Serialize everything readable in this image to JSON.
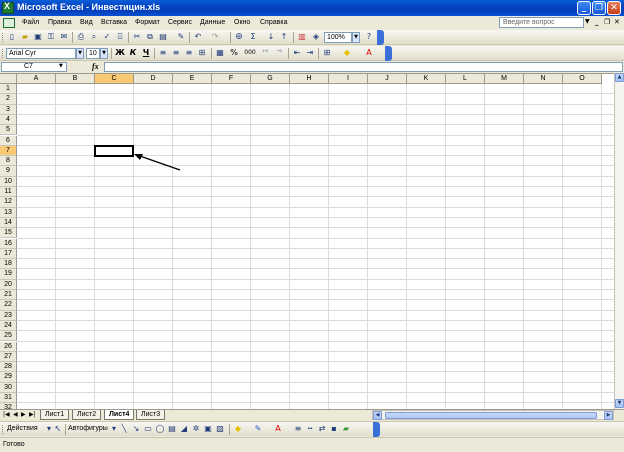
{
  "window": {
    "title": "Microsoft Excel - Инвестицин.xls"
  },
  "menu": {
    "items": [
      "Файл",
      "Правка",
      "Вид",
      "Вставка",
      "Формат",
      "Сервис",
      "Данные",
      "Окно",
      "Справка"
    ],
    "ask_placeholder": "Введите вопрос"
  },
  "standard_toolbar": {
    "zoom": "100%"
  },
  "format_toolbar": {
    "font": "Arial Cyr",
    "size": "10",
    "bold": "Ж",
    "italic": "К",
    "underline": "Ч",
    "percent": "%",
    "thousands": "000"
  },
  "formula_bar": {
    "name_box": "C7",
    "fx": "fx",
    "value": ""
  },
  "grid": {
    "columns": [
      "A",
      "B",
      "C",
      "D",
      "E",
      "F",
      "G",
      "H",
      "I",
      "J",
      "K",
      "L",
      "M",
      "N",
      "O"
    ],
    "rows": [
      "1",
      "2",
      "3",
      "4",
      "5",
      "6",
      "7",
      "8",
      "9",
      "10",
      "11",
      "12",
      "13",
      "14",
      "15",
      "16",
      "17",
      "18",
      "19",
      "20",
      "21",
      "22",
      "23",
      "24",
      "25",
      "26",
      "27",
      "28",
      "29",
      "30",
      "31",
      "32"
    ],
    "active_cell": "C7"
  },
  "sheets": {
    "tabs": [
      "Лист1",
      "Лист2",
      "Лист4",
      "Лист3"
    ],
    "active": "Лист4"
  },
  "drawing_toolbar": {
    "actions": "Действия",
    "autoshapes": "Автофигуры"
  },
  "status": {
    "text": "Готово"
  },
  "colors": {
    "title_bar": "#0A52D4",
    "selected_header": "#F9C974",
    "toolbar_end": "#3A6FD8"
  }
}
